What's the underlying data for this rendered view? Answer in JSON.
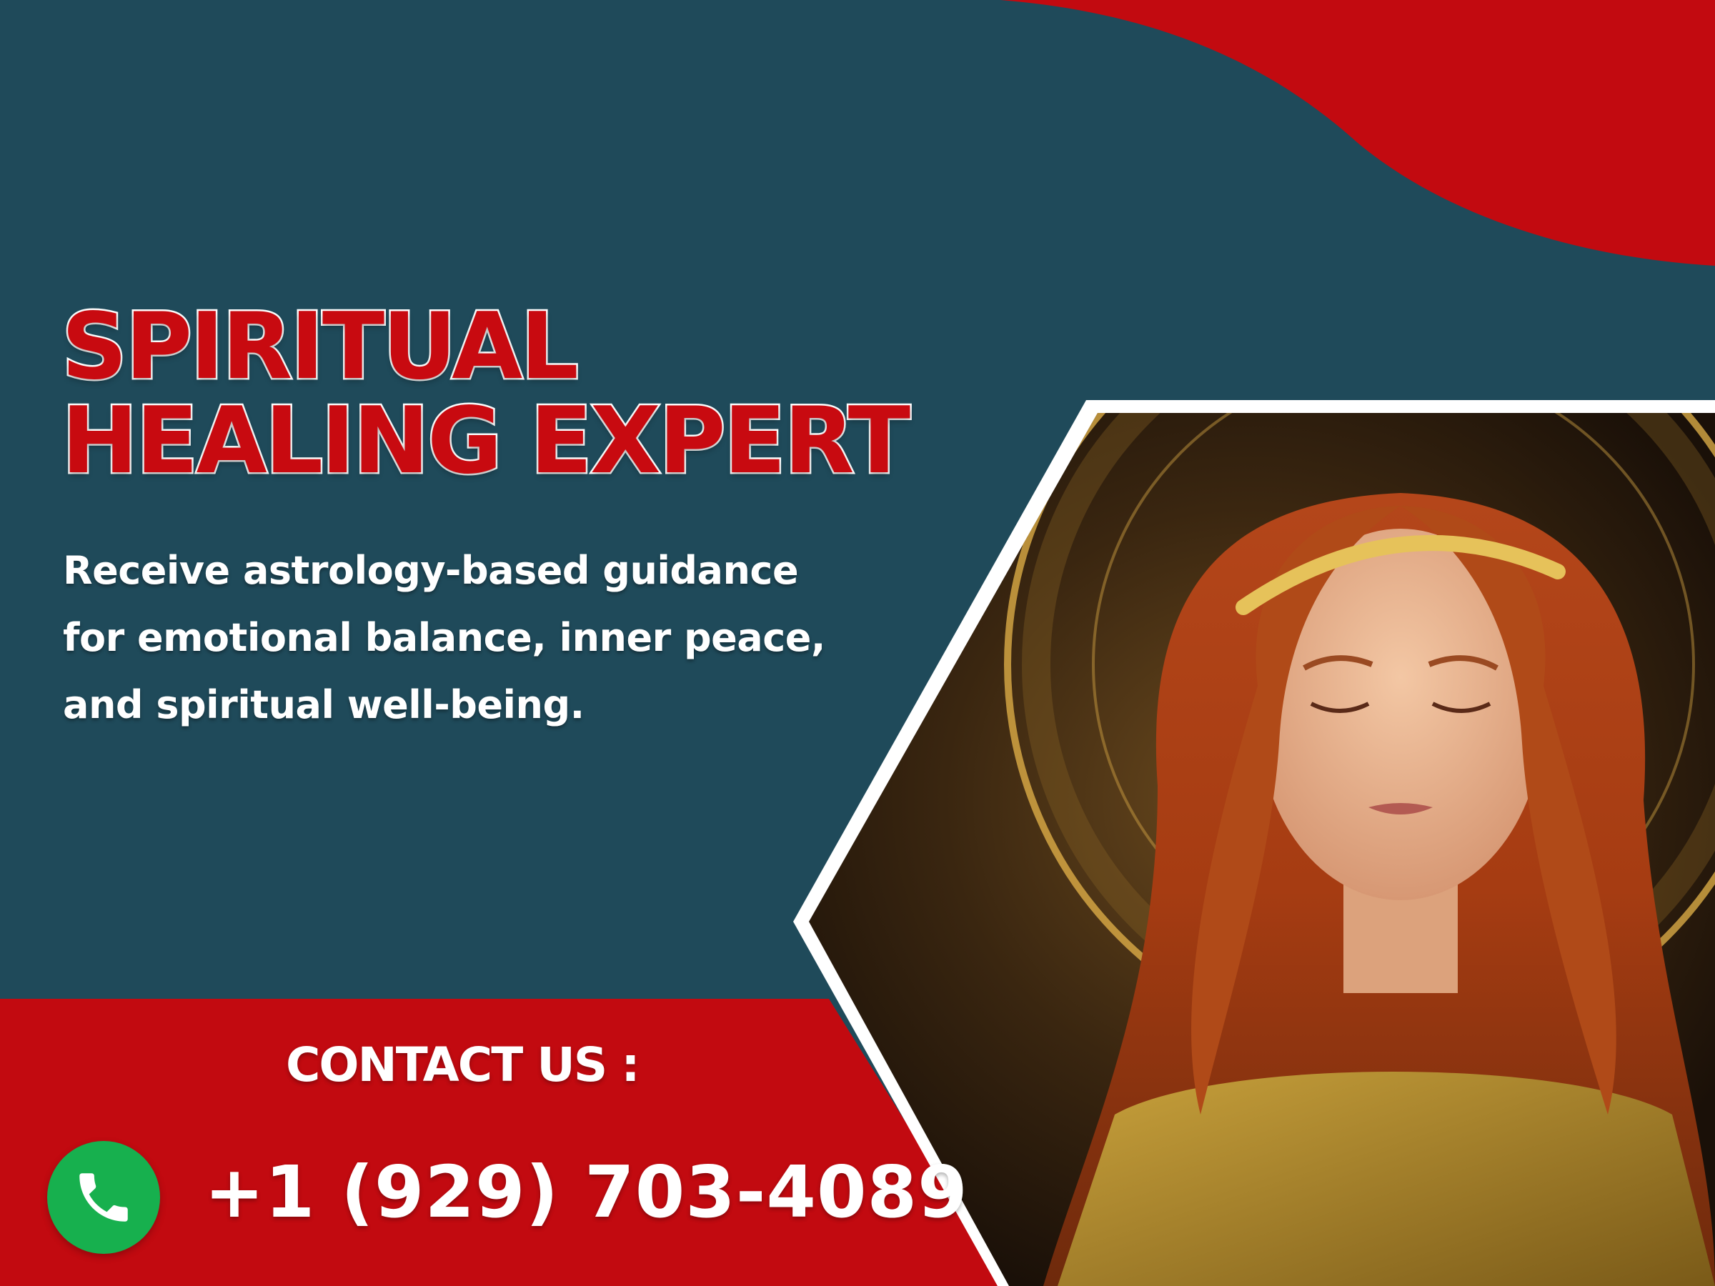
{
  "headline": {
    "line1": "SPIRITUAL",
    "line2": "HEALING EXPERT"
  },
  "description": "Receive astrology-based guidance for emotional balance, inner peace, and spiritual well-being.",
  "contact": {
    "label": "CONTACT US :",
    "phone": "+1 (929) 703-4089",
    "icon": "phone-icon"
  },
  "portrait": {
    "subject": "woman-meditating-photo"
  },
  "colors": {
    "teal_background": "#1f4a5a",
    "brand_red": "#c80a10",
    "white": "#ffffff",
    "phone_green": "#17b04e",
    "gold_glow": "#e6b44a"
  }
}
